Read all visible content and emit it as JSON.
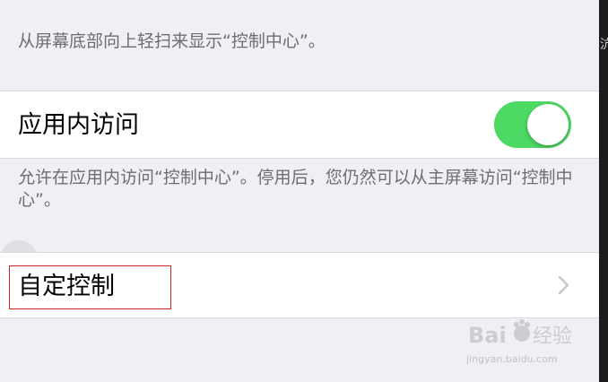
{
  "footer_top": "从屏幕底部向上轻扫来显示“控制中心”。",
  "access_in_apps": {
    "label": "应用内访问",
    "toggle_on": true,
    "toggle_color": "#4cd964"
  },
  "footer_access": "允许在应用内访问“控制中心”。停用后，您仍然可以从主屏幕访问“控制中心”。",
  "customize": {
    "label": "自定控制"
  },
  "right_strip_glyph": "沆",
  "watermark": {
    "brand": "Bai du 经验",
    "url": "jingyan.baidu.com"
  },
  "colors": {
    "background": "#efeff4",
    "cell": "#ffffff",
    "secondary_text": "#6d6d72",
    "highlight": "#c9262a"
  }
}
